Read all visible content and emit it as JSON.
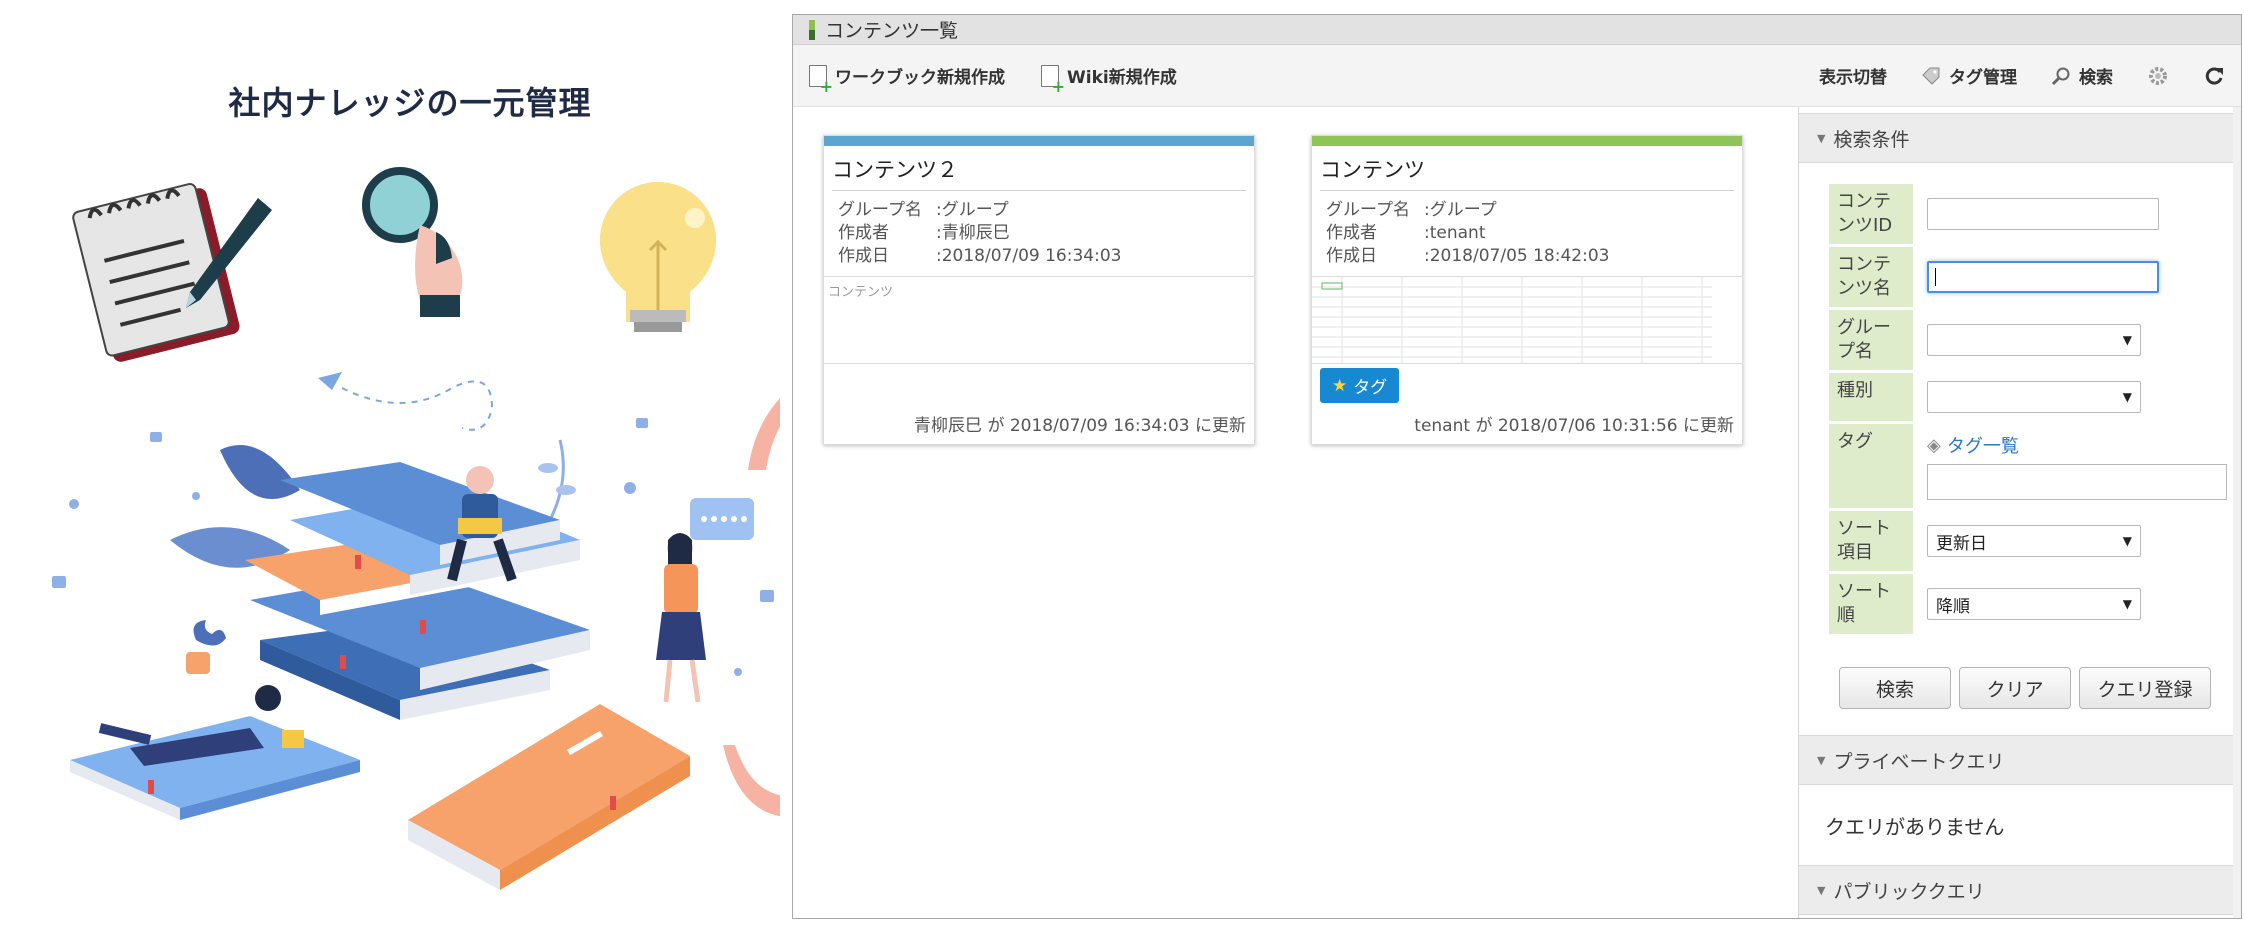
{
  "headline": "社内ナレッジの一元管理",
  "window": {
    "title": "コンテンツ一覧"
  },
  "toolbar": {
    "new_workbook": "ワークブック新規作成",
    "new_wiki": "Wiki新規作成",
    "display_switch": "表示切替",
    "tag_management": "タグ管理",
    "search": "検索"
  },
  "cards": [
    {
      "title": "コンテンツ２",
      "accent": "#5aa6d0",
      "group_label": "グループ名",
      "group": ":グループ",
      "author_label": "作成者",
      "author": ":青柳辰巳",
      "created_label": "作成日",
      "created": ":2018/07/09 16:34:03",
      "preview_text": "コンテンツ",
      "footer": "青柳辰巳 が 2018/07/09 16:34:03 に更新"
    },
    {
      "title": "コンテンツ",
      "accent": "#8fc457",
      "group_label": "グループ名",
      "group": ":グループ",
      "author_label": "作成者",
      "author": ":tenant",
      "created_label": "作成日",
      "created": ":2018/07/05 18:42:03",
      "tag": "タグ",
      "footer": "tenant が 2018/07/06 10:31:56 に更新"
    }
  ],
  "search_panel": {
    "heading": "検索条件",
    "fields": {
      "content_id": "コンテンツID",
      "content_name": "コンテンツ名",
      "group_name": "グループ名",
      "type": "種別",
      "tag": "タグ",
      "tag_list": "タグ一覧",
      "sort_item": "ソート項目",
      "sort_item_value": "更新日",
      "sort_order": "ソート順",
      "sort_order_value": "降順"
    },
    "buttons": {
      "search": "検索",
      "clear": "クリア",
      "register_query": "クエリ登録"
    },
    "private_query": {
      "heading": "プライベートクエリ",
      "empty": "クエリがありません"
    },
    "public_query": {
      "heading": "パブリッククエリ"
    }
  }
}
